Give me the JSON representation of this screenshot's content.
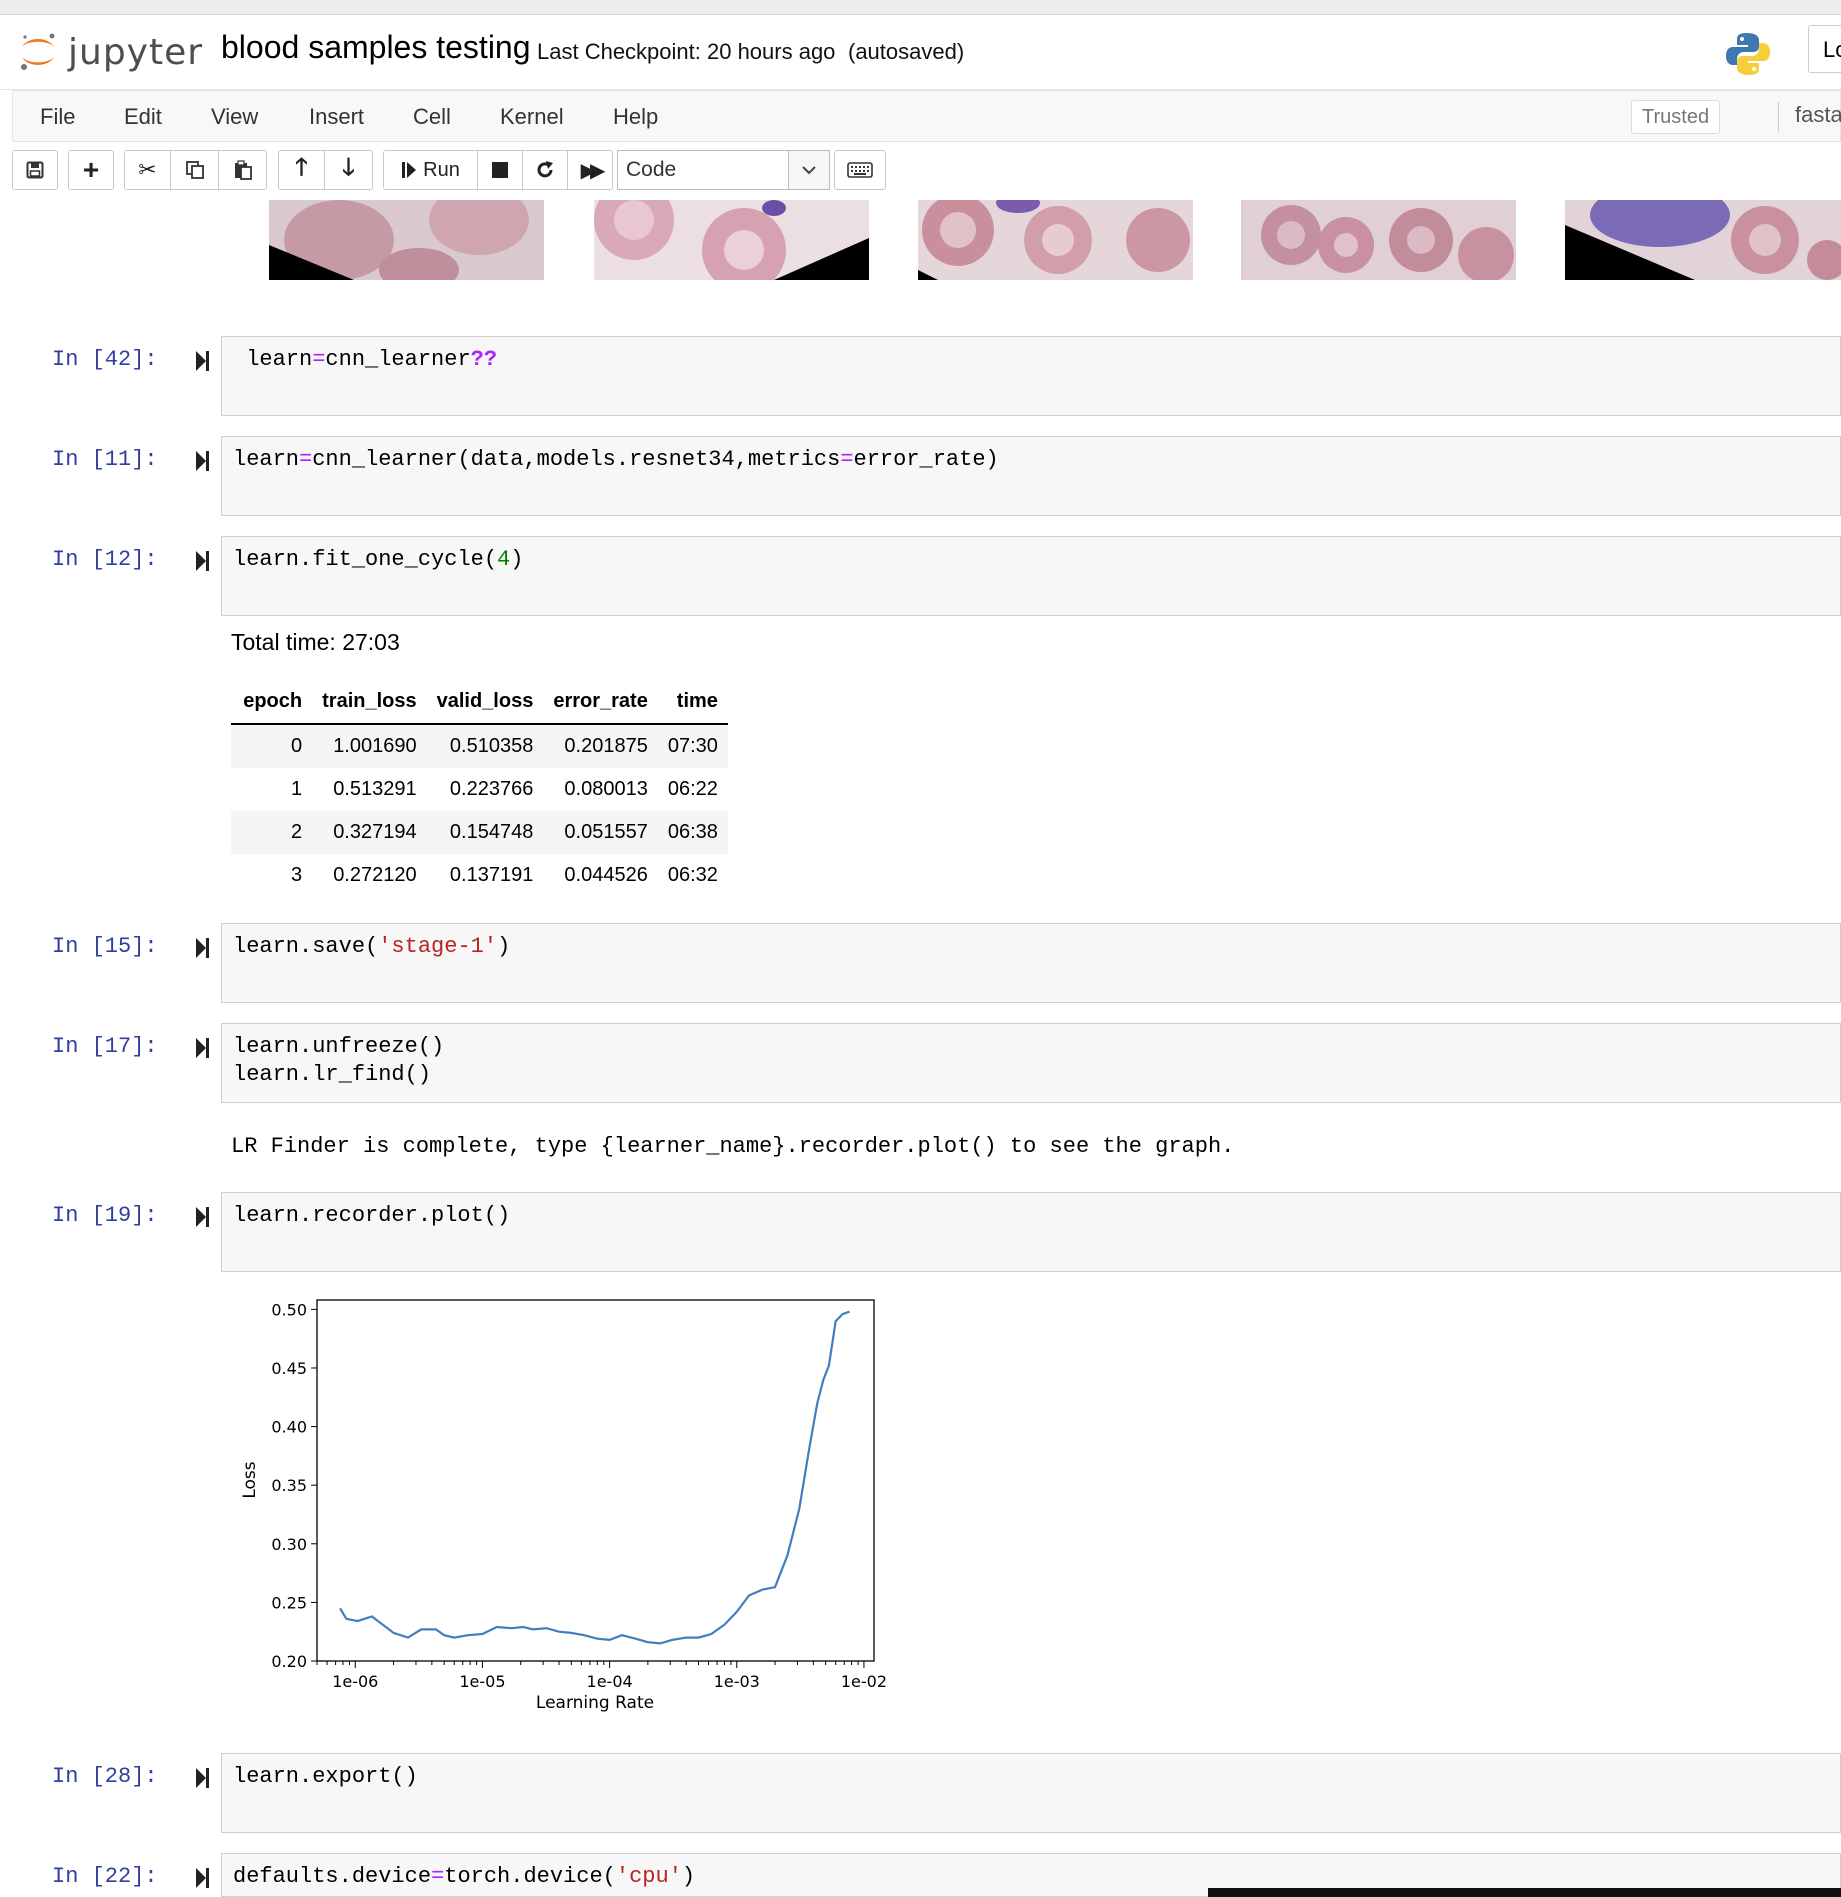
{
  "app": {
    "name": "jupyter",
    "notebook_title": "blood samples testing",
    "checkpoint": "Last Checkpoint: 20 hours ago",
    "autosave_status": "(autosaved)",
    "logout_label": "Lo",
    "trusted_label": "Trusted",
    "kernel_name": "fastai_"
  },
  "menu": [
    "File",
    "Edit",
    "View",
    "Insert",
    "Cell",
    "Kernel",
    "Help"
  ],
  "toolbar": {
    "run_label": "Run",
    "cell_type": "Code"
  },
  "cells": [
    {
      "prompt": "In [42]:",
      "code": "learn=cnn_learner??"
    },
    {
      "prompt": "In [11]:",
      "code": "learn=cnn_learner(data,models.resnet34,metrics=error_rate)"
    },
    {
      "prompt": "In [12]:",
      "code": "learn.fit_one_cycle(4)"
    },
    {
      "prompt": "In [15]:",
      "code": "learn.save('stage-1')"
    },
    {
      "prompt": "In [17]:",
      "code": "learn.unfreeze()\nlearn.lr_find()"
    },
    {
      "prompt": "In [19]:",
      "code": "learn.recorder.plot()"
    },
    {
      "prompt": "In [28]:",
      "code": "learn.export()"
    },
    {
      "prompt": "In [22]:",
      "code": "defaults.device=torch.device('cpu')"
    }
  ],
  "outputs": {
    "total_time": "Total time: 27:03",
    "lr_finder_msg": "LR Finder is complete, type {learner_name}.recorder.plot() to see the graph."
  },
  "results_table": {
    "headers": [
      "epoch",
      "train_loss",
      "valid_loss",
      "error_rate",
      "time"
    ],
    "rows": [
      [
        "0",
        "1.001690",
        "0.510358",
        "0.201875",
        "07:30"
      ],
      [
        "1",
        "0.513291",
        "0.223766",
        "0.080013",
        "06:22"
      ],
      [
        "2",
        "0.327194",
        "0.154748",
        "0.051557",
        "06:38"
      ],
      [
        "3",
        "0.272120",
        "0.137191",
        "0.044526",
        "06:32"
      ]
    ]
  },
  "chart_data": {
    "type": "line",
    "xlabel": "Learning Rate",
    "ylabel": "Loss",
    "xscale": "log",
    "xlim": [
      5e-07,
      0.012
    ],
    "ylim": [
      0.2,
      0.508
    ],
    "xticks": [
      "1e-06",
      "1e-05",
      "1e-04",
      "1e-03",
      "1e-02"
    ],
    "yticks": [
      "0.20",
      "0.25",
      "0.30",
      "0.35",
      "0.40",
      "0.45",
      "0.50"
    ],
    "color": "#3f7fbf",
    "x": [
      7.6e-07,
      8.5e-07,
      1.04e-06,
      1.35e-06,
      1.6e-06,
      2e-06,
      2.6e-06,
      3.3e-06,
      4.3e-06,
      5e-06,
      6e-06,
      7.7e-06,
      1e-05,
      1.3e-05,
      1.7e-05,
      2.1e-05,
      2.5e-05,
      3.2e-05,
      4e-05,
      5e-05,
      6.3e-05,
      8e-05,
      0.0001,
      0.000125,
      0.00016,
      0.0002,
      0.00025,
      0.00031,
      0.0004,
      0.0005,
      0.00063,
      0.0008,
      0.001,
      0.00125,
      0.0016,
      0.002,
      0.0025,
      0.0031,
      0.0037,
      0.0043,
      0.0048,
      0.0053,
      0.006,
      0.0068,
      0.0077
    ],
    "y": [
      0.245,
      0.236,
      0.234,
      0.238,
      0.232,
      0.224,
      0.22,
      0.227,
      0.227,
      0.222,
      0.22,
      0.222,
      0.223,
      0.229,
      0.228,
      0.229,
      0.227,
      0.228,
      0.225,
      0.224,
      0.222,
      0.219,
      0.218,
      0.222,
      0.219,
      0.216,
      0.215,
      0.218,
      0.22,
      0.22,
      0.223,
      0.231,
      0.242,
      0.256,
      0.261,
      0.263,
      0.29,
      0.33,
      0.38,
      0.42,
      0.44,
      0.452,
      0.49,
      0.496,
      0.498
    ]
  }
}
